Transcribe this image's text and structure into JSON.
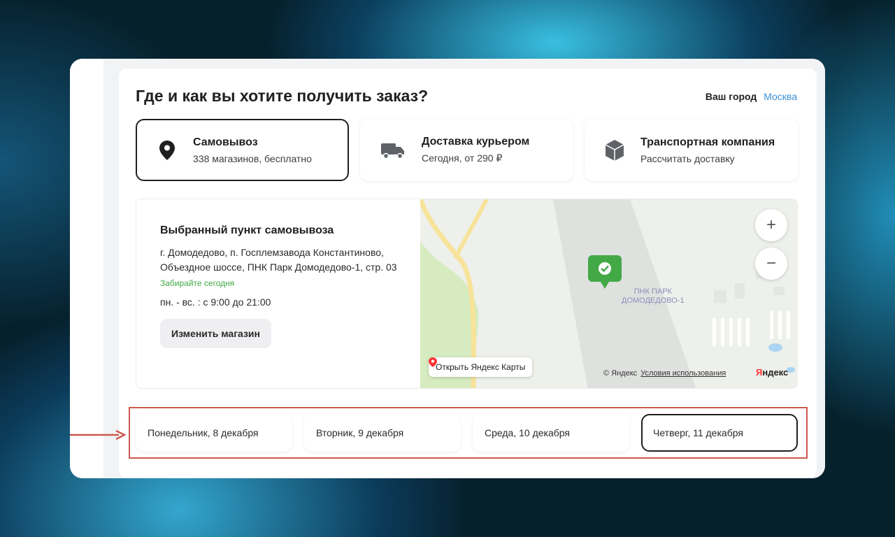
{
  "header": {
    "title": "Где и как вы хотите получить заказ?",
    "city_label": "Ваш город",
    "city_value": "Москва"
  },
  "delivery_options": [
    {
      "title": "Самовывоз",
      "subtitle": "338 магазинов, бесплатно",
      "icon": "location-pin-icon",
      "selected": true
    },
    {
      "title": "Доставка курьером",
      "subtitle": "Сегодня, от 290 ₽",
      "icon": "truck-icon",
      "selected": false
    },
    {
      "title": "Транспортная компания",
      "subtitle": "Рассчитать доставку",
      "icon": "package-box-icon",
      "selected": false
    }
  ],
  "pickup": {
    "title": "Выбранный пункт самовывоза",
    "address": "г. Домодедово, п. Госплемзавода Константиново, Объездное шоссе, ПНК Парк Домодедово-1, стр. 03",
    "status": "Забирайте сегодня",
    "hours": "пн. - вс. : с 9:00 до 21:00",
    "change_button": "Изменить магазин"
  },
  "map": {
    "zoom_in": "+",
    "zoom_out": "−",
    "place_label_line1": "ПНК ПАРК",
    "place_label_line2": "ДОМОДЕДОВО-1",
    "open_button": "Открыть Яндекс Карты",
    "copyright": "© Яндекс",
    "terms_link": "Условия использования",
    "logo_first": "Я",
    "logo_rest": "ндекс",
    "colors": {
      "marker": "#43a947",
      "road": "#f7e39a",
      "park": "#d6ecc0"
    }
  },
  "dates": [
    {
      "label": "Понедельник, 8 декабря",
      "selected": false
    },
    {
      "label": "Вторник, 9 декабря",
      "selected": false
    },
    {
      "label": "Среда, 10 декабря",
      "selected": false
    },
    {
      "label": "Четверг, 11 декабря",
      "selected": true
    }
  ],
  "annotation": {
    "color": "#cc5a4e"
  }
}
